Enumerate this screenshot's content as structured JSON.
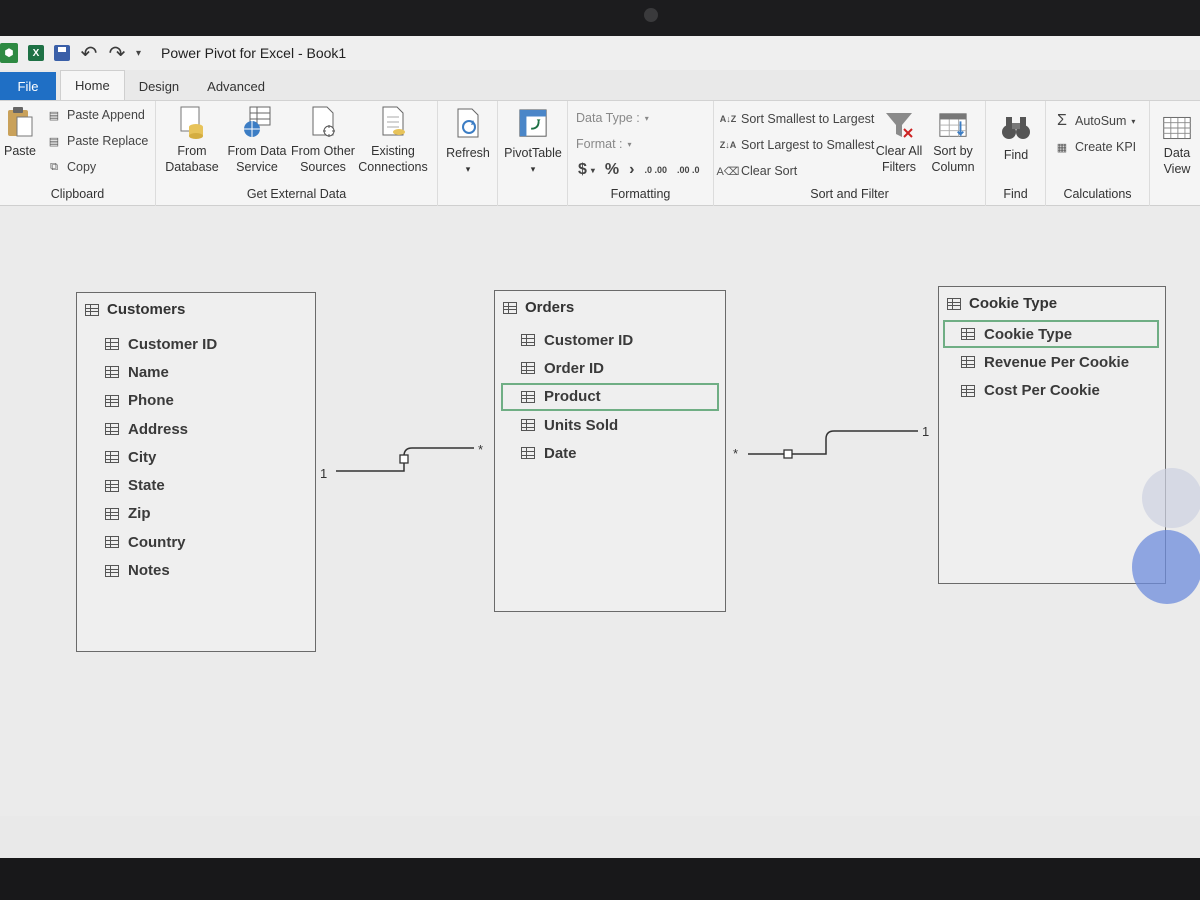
{
  "window": {
    "title": "Power Pivot for Excel - Book1"
  },
  "qat": {
    "pp_icon": "power-pivot-icon",
    "xl_label": "X",
    "more": "▾"
  },
  "tabs": [
    {
      "label": "File"
    },
    {
      "label": "Home"
    },
    {
      "label": "Design"
    },
    {
      "label": "Advanced"
    }
  ],
  "ribbon": {
    "clipboard": {
      "label": "Clipboard",
      "paste": "Paste",
      "paste_append": "Paste Append",
      "paste_replace": "Paste Replace",
      "copy": "Copy"
    },
    "external": {
      "label": "Get External Data",
      "from_database": "From Database",
      "from_data_service": "From Data Service",
      "from_other_sources": "From Other Sources",
      "existing_connections": "Existing Connections"
    },
    "refresh": {
      "label": "Refresh"
    },
    "pivot": {
      "label": "PivotTable"
    },
    "formatting": {
      "label": "Formatting",
      "data_type": "Data Type :",
      "format": "Format :",
      "currency": "$",
      "percent": "%",
      "comma": "›",
      "inc_decimal": ".0 .00",
      "dec_decimal": ".00 .0"
    },
    "sort": {
      "label": "Sort and Filter",
      "smallest_largest": "Sort Smallest to Largest",
      "largest_smallest": "Sort Largest to Smallest",
      "clear_sort": "Clear Sort",
      "clear_all_filters": "Clear All Filters",
      "sort_by_column": "Sort by Column"
    },
    "find": {
      "label": "Find",
      "button": "Find"
    },
    "calculations": {
      "label": "Calculations",
      "autosum": "AutoSum",
      "create_kpi": "Create KPI"
    },
    "view": {
      "data_view": "Data View"
    }
  },
  "tables": {
    "customers": {
      "title": "Customers",
      "fields": [
        "Customer ID",
        "Name",
        "Phone",
        "Address",
        "City",
        "State",
        "Zip",
        "Country",
        "Notes"
      ]
    },
    "orders": {
      "title": "Orders",
      "fields": [
        "Customer ID",
        "Order ID",
        "Product",
        "Units Sold",
        "Date"
      ],
      "highlighted": "Product"
    },
    "cookie_type": {
      "title": "Cookie Type",
      "fields": [
        "Cookie Type",
        "Revenue Per Cookie",
        "Cost Per Cookie"
      ],
      "highlighted": "Cookie Type"
    }
  },
  "relationships": {
    "customers_orders": {
      "one": "1",
      "many": "*"
    },
    "orders_cookie": {
      "many": "*",
      "one": "1"
    }
  }
}
